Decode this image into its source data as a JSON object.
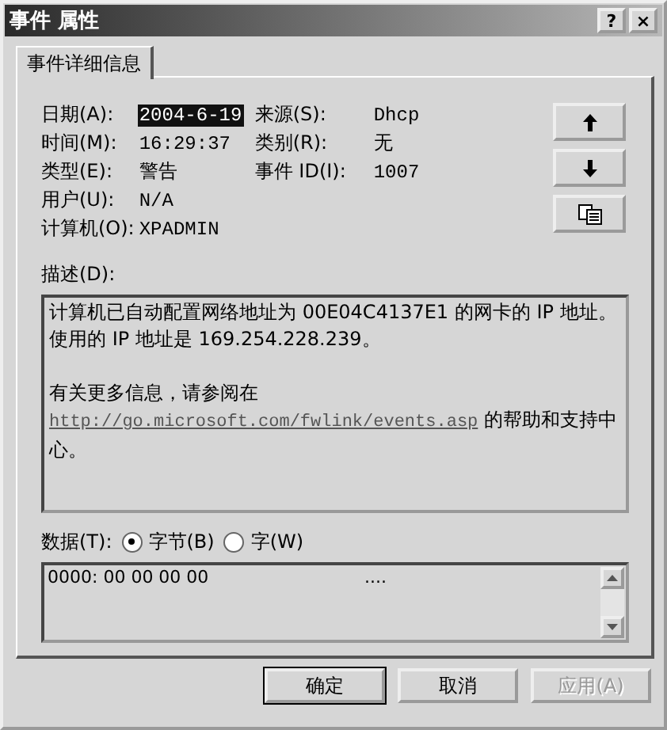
{
  "window": {
    "title": "事件 属性",
    "help_button": "?",
    "close_button": "×"
  },
  "tabs": [
    {
      "label": "事件详细信息",
      "selected": true
    }
  ],
  "field_rows": [
    {
      "fields": [
        {
          "label": "日期(A):",
          "value": "2004-6-19",
          "selected": true
        },
        {
          "label": "来源(S):",
          "value": "Dhcp",
          "selected": false
        }
      ]
    },
    {
      "fields": [
        {
          "label": "时间(M):",
          "value": "16:29:37",
          "selected": false
        },
        {
          "label": "类别(R):",
          "value": "无",
          "selected": false
        }
      ]
    },
    {
      "fields": [
        {
          "label": "类型(E):",
          "value": "警告",
          "selected": false
        },
        {
          "label": "事件 ID(I):",
          "value": "1007",
          "selected": false
        }
      ]
    },
    {
      "fields": [
        {
          "label": "用户(U):",
          "value": "N/A",
          "selected": false
        }
      ]
    },
    {
      "fields": [
        {
          "label": "计算机(O):",
          "value": "XPADMIN",
          "selected": false
        }
      ]
    }
  ],
  "nav_buttons": [
    {
      "kind": "up"
    },
    {
      "kind": "down"
    },
    {
      "kind": "copy"
    }
  ],
  "description": {
    "label": "描述(D):",
    "sentences": [
      "计算机已自动配置网络地址为 00E04C4137E1 的网卡的 IP 地址。",
      "使用的 IP 地址是 169.254.228.239。"
    ],
    "more_text": "有关更多信息，请参阅在",
    "link": "http://go.microsoft.com/fwlink/events.asp",
    "after_link": "的帮助和支持中心。"
  },
  "data": {
    "label": "数据(T):",
    "radios": [
      {
        "label": "字节(B)",
        "selected": true
      },
      {
        "label": "字(W)",
        "selected": false
      }
    ],
    "hex": "0000: 00 00 00 00",
    "ascii": "...."
  },
  "buttons": [
    {
      "label": "确定",
      "default": true,
      "disabled": false
    },
    {
      "label": "取消",
      "default": false,
      "disabled": false
    },
    {
      "label": "应用(A)",
      "default": false,
      "disabled": true
    }
  ]
}
